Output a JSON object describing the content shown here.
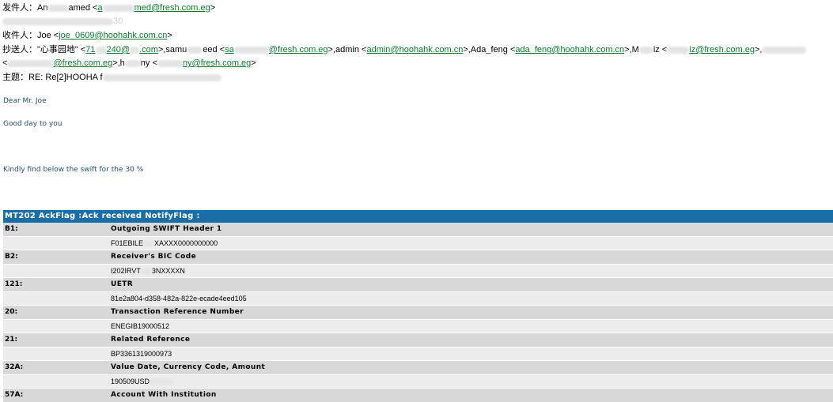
{
  "headers": {
    "from_label": "发件人：",
    "from_name": "An",
    "from_name_tail": "amed",
    "from_email_head": "a",
    "from_email_tail": "med@fresh.com.eg",
    "line2_tail": "30",
    "to_label": "收件人：",
    "to_name": "Joe",
    "to_email": "joe_0609@hoohahk.com.cn",
    "cc_label": "抄送人：",
    "cc_1_name": "\"心事园地\"",
    "cc_1_email_head": "71",
    "cc_1_email_mid": "240@",
    "cc_1_email_tail": ".com",
    "cc_2_name_head": "samu",
    "cc_2_name_tail": "eed",
    "cc_2_email_head": "sa",
    "cc_2_email_tail": "@fresh.com.eg",
    "cc_3_name": "admin",
    "cc_3_email": "admin@hoohahk.com.cn",
    "cc_4_name": "Ada_feng",
    "cc_4_email": "ada_feng@hoohahk.com.cn",
    "cc_5_name_head": "M",
    "cc_5_name_tail": "iz",
    "cc_5_email_tail": "iz@fresh.com.eg",
    "cc_6_email_tail": "@fresh.com.eg",
    "cc_7_name_head": "h",
    "cc_7_name_tail": "ny",
    "cc_7_email_tail": "ny@fresh.com.eg",
    "subject_label": "主题：",
    "subject": "RE: Re[2]HOOHA f"
  },
  "body": {
    "greeting": "Dear Mr. Joe",
    "line1": "Good day to you",
    "line2": "Kindly find below the swift for the 30 %"
  },
  "swift": {
    "title": "MT202 AckFlag :Ack received NotifyFlag :",
    "rows": [
      {
        "tag": "B1:",
        "desc": "Outgoing SWIFT Header 1",
        "value": "F01EBILE",
        "value_tail": "XAXXX0000000000"
      },
      {
        "tag": "B2:",
        "desc": "Receiver's BIC Code",
        "value": "I202IRVT",
        "value_tail": "3NXXXXN"
      },
      {
        "tag": "121:",
        "desc": "UETR",
        "value": "81e2a804-d358-482a-822e-ecade4eed105",
        "value_tail": ""
      },
      {
        "tag": "20:",
        "desc": "Transaction Reference Number",
        "value": "ENEGIB19000512",
        "value_tail": ""
      },
      {
        "tag": "21:",
        "desc": "Related Reference",
        "value": "BP3361319000973",
        "value_tail": ""
      },
      {
        "tag": "32A:",
        "desc": "Value Date, Currency Code, Amount",
        "value": "190509USD",
        "value_tail": ""
      },
      {
        "tag": "57A:",
        "desc": "Account With Institution",
        "value": "",
        "value_tail": ""
      }
    ]
  }
}
